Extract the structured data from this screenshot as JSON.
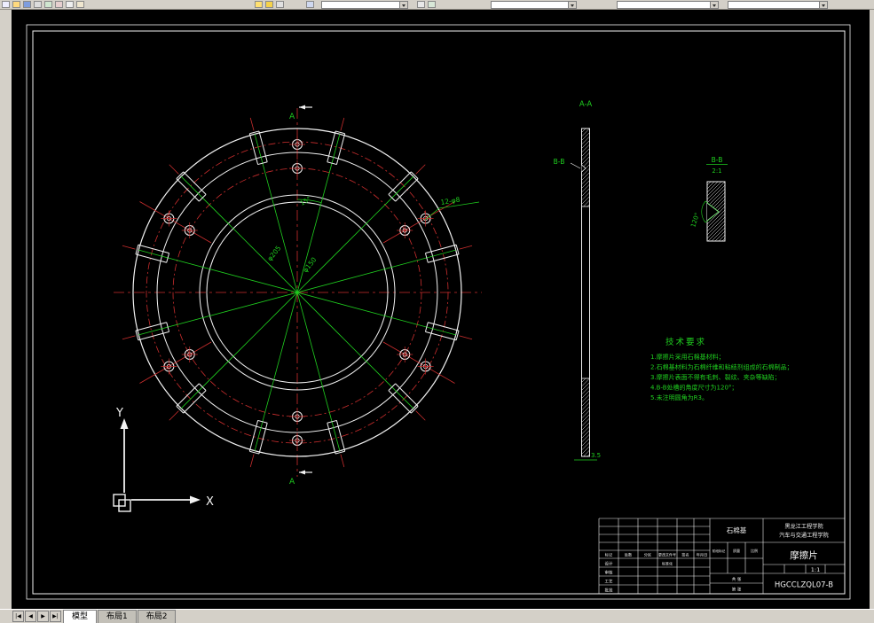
{
  "colors": {
    "line": "#f2f2f2",
    "center": "#cc2e2e",
    "dim": "#1fcf1f",
    "chrome": "#d4d0c8",
    "bg": "#000000"
  },
  "toolbar": {
    "icons": [
      "new-file",
      "open-file",
      "save",
      "print",
      "preview",
      "cut",
      "copy",
      "paste",
      "color-swatch",
      "linetype",
      "layers",
      "properties",
      "match",
      "help"
    ],
    "combos": {
      "layer": {
        "value": ""
      },
      "color": {
        "value": ""
      },
      "linetype": {
        "value": ""
      },
      "lineweight": {
        "value": ""
      }
    }
  },
  "tabs": {
    "nav": [
      "|◀",
      "◀",
      "▶",
      "▶|"
    ],
    "model": "模型",
    "layout1": "布局1",
    "layout2": "布局2"
  },
  "drawing": {
    "main_view": {
      "section_top": "A",
      "section_bottom": "A",
      "dim1": "φ205",
      "dim2": "φ150",
      "angle": "15°",
      "holes": "12-φ8"
    },
    "section_aa": {
      "title": "A-A",
      "cut": "B-B",
      "thickness": "3.5"
    },
    "detail_bb": {
      "title": "B-B",
      "scale": "2:1",
      "angle": "120°"
    },
    "tech": {
      "title": "技术要求",
      "items": [
        "1.摩擦片采用石棉基材料；",
        "2.石棉基材料为石棉纤维和粘结剂组成的石棉制品；",
        "3.摩擦片表面不得有毛刺、裂纹、夹杂等缺陷；",
        "4.B-B处槽的角度尺寸为120°；",
        "5.未注明圆角为R3。"
      ]
    },
    "title_block": {
      "school1": "黑龙江工程学院",
      "school2": "汽车与交通工程学院",
      "material": "石棉基",
      "part": "摩擦片",
      "number": "HGCCLZQL07-B",
      "scale": "1:1",
      "labels": {
        "mark": "标记",
        "count": "处数",
        "zone": "分区",
        "file": "更改文件号",
        "sign": "签名",
        "date": "年月日",
        "design": "设计",
        "check": "审核",
        "craft": "工艺",
        "approve": "批准",
        "std": "标准化",
        "stage": "阶段标记",
        "mass": "质量",
        "ratio": "比例",
        "total": "共 张",
        "page": "第 张"
      }
    }
  }
}
